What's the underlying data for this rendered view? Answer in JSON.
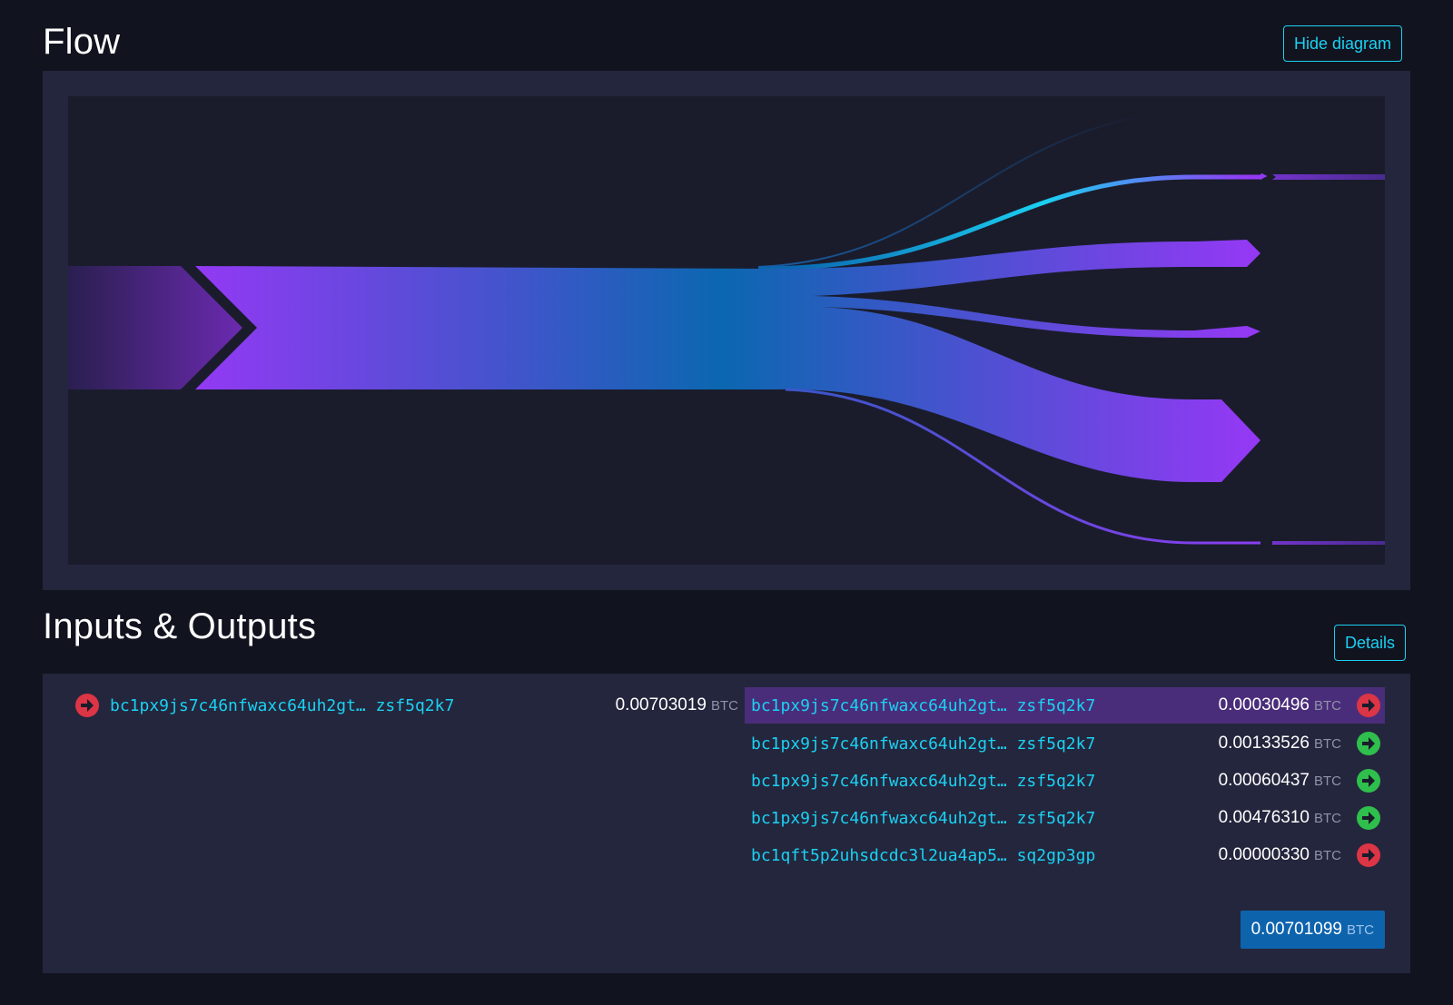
{
  "flow": {
    "title": "Flow",
    "hide_button_label": "Hide diagram"
  },
  "io": {
    "title": "Inputs & Outputs",
    "details_button_label": "Details",
    "unit": "BTC",
    "inputs": [
      {
        "address": "bc1px9js7c46nfwaxc64uh2gt… zsf5q2k7",
        "amount": "0.00703019",
        "arrow_color": "red"
      }
    ],
    "outputs": [
      {
        "address": "bc1px9js7c46nfwaxc64uh2gt… zsf5q2k7",
        "amount": "0.00030496",
        "arrow_color": "red",
        "highlighted": true
      },
      {
        "address": "bc1px9js7c46nfwaxc64uh2gt… zsf5q2k7",
        "amount": "0.00133526",
        "arrow_color": "green"
      },
      {
        "address": "bc1px9js7c46nfwaxc64uh2gt… zsf5q2k7",
        "amount": "0.00060437",
        "arrow_color": "green"
      },
      {
        "address": "bc1px9js7c46nfwaxc64uh2gt… zsf5q2k7",
        "amount": "0.00476310",
        "arrow_color": "green"
      },
      {
        "address": "bc1qft5p2uhsdcdc3l2ua4ap5… sq2gp3gp",
        "amount": "0.00000330",
        "arrow_color": "red"
      }
    ],
    "total_amount": "0.00701099"
  },
  "colors": {
    "background": "#11131f",
    "panel": "#24263d",
    "accent": "#1bd1f2",
    "flow_purple": "#9339f4",
    "flow_blue": "#0b67b0",
    "arrow_red": "#dc3545",
    "arrow_green": "#2fbf4c",
    "total_badge": "#0e63ad",
    "highlight_row": "#4a2d7a"
  },
  "icons": {
    "spend_arrow": "arrow-circle-right-icon"
  }
}
